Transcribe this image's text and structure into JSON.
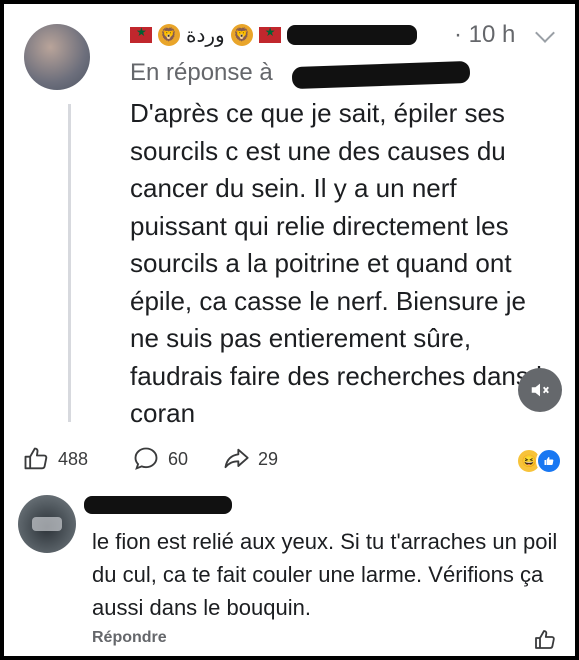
{
  "post": {
    "author_name": "وردة",
    "time": "· 10 h",
    "reply_prefix": "En réponse à",
    "text": "D'après ce que je sait, épiler ses sourcils c est une des causes du cancer du sein. Il y a un nerf puissant qui relie directement les sourcils a la poitrine et quand ont épile, ca casse le nerf. Biensure je ne suis pas entierement sûre, faudrais faire des recherches dans le coran"
  },
  "stats": {
    "likes": "488",
    "comments": "60",
    "shares": "29"
  },
  "comment": {
    "text": "le fion est relié aux yeux. Si tu t'arraches un poil du cul, ca te fait couler une larme. Vérifions ça aussi dans le bouquin.",
    "reply_label": "Répondre"
  },
  "colors": {
    "secondary_text": "#65676b",
    "like_blue": "#1877f2",
    "flag_red": "#c1272d"
  },
  "icons": [
    "like-icon",
    "comment-icon",
    "share-icon",
    "mute-icon",
    "haha-reaction-icon",
    "like-reaction-icon",
    "chevron-down-icon"
  ]
}
